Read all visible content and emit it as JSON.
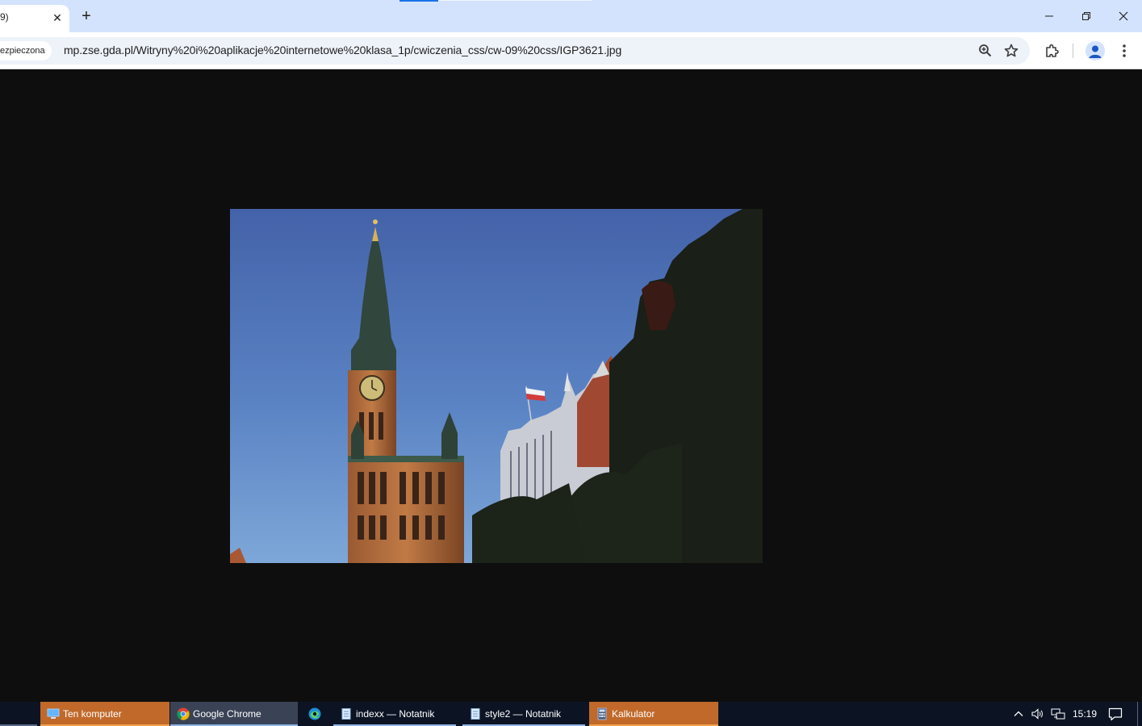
{
  "tab": {
    "title": "9)",
    "close_glyph": "✕"
  },
  "newtab_glyph": "+",
  "window_controls": {
    "minimize": "minimize-icon",
    "restore": "restore-icon",
    "close": "close-icon"
  },
  "omnibox": {
    "security_label": "ezpieczona",
    "url": "mp.zse.gda.pl/Witryny%20i%20aplikacje%20internetowe%20klasa_1p/cwiczenia_css/cw-09%20css/IGP3621.jpg"
  },
  "toolbar_icons": [
    "zoom-icon",
    "bookmark-star-icon",
    "extensions-icon",
    "profile-icon",
    "menu-icon"
  ],
  "colors": {
    "tabstrip": "#d3e3fd",
    "omnibox": "#eef2f9",
    "viewport": "#0e0e0e",
    "taskbar": "#0c1424",
    "task_highlight": "#c0692a",
    "accent": "#1a73e8"
  },
  "taskbar": {
    "items": [
      {
        "label": "Ten komputer",
        "icon": "computer-icon"
      },
      {
        "label": "Google Chrome",
        "icon": "chrome-icon"
      },
      {
        "label": "",
        "icon": "edge-icon"
      },
      {
        "label": "indexx — Notatnik",
        "icon": "notepad-icon"
      },
      {
        "label": "style2 — Notatnik",
        "icon": "notepad-icon"
      },
      {
        "label": "Kalkulator",
        "icon": "calculator-icon"
      }
    ],
    "tray": {
      "time": "15:19"
    }
  }
}
